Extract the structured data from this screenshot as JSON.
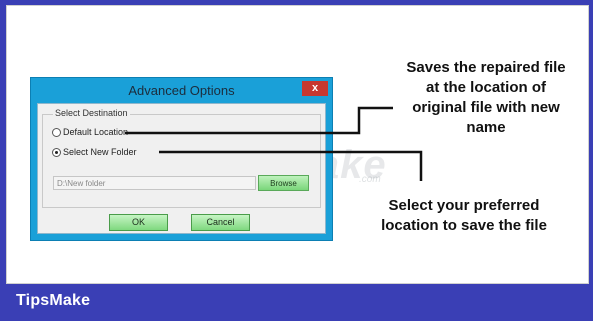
{
  "brand": "TipsMake",
  "watermark": {
    "text": "TipsMake",
    "suffix": ".com"
  },
  "dialog": {
    "title": "Advanced Options",
    "close_glyph": "x",
    "group_label": "Select Destination",
    "option_default": "Default Location",
    "option_new_folder": "Select New Folder",
    "selected_option": "Select New Folder",
    "path_value": "D:\\New folder",
    "browse_label": "Browse",
    "ok_label": "OK",
    "cancel_label": "Cancel"
  },
  "annotations": {
    "default_location_lines": [
      "Saves the repaired file",
      "at the location of",
      "original file with new",
      "name"
    ],
    "new_folder_lines": [
      "Select your preferred",
      "location to save the file"
    ]
  },
  "colors": {
    "frame": "#3a3fb5",
    "dialog_chrome": "#1aa0d8",
    "close": "#c7372f",
    "button_green": "#7fd87f"
  }
}
